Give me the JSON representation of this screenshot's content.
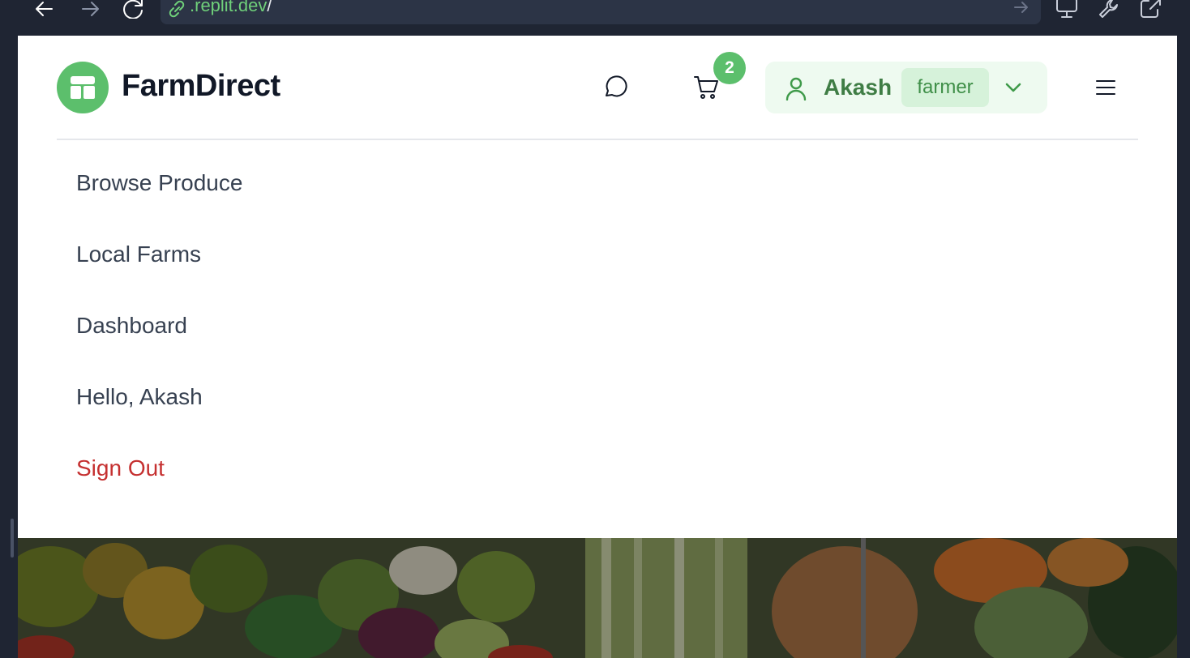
{
  "browser": {
    "url_host": ".replit.dev",
    "url_path": "/",
    "icons": [
      "back-arrow-icon",
      "forward-arrow-icon",
      "reload-icon",
      "link-icon",
      "go-arrow-icon",
      "monitor-icon",
      "wrench-icon",
      "external-link-icon"
    ]
  },
  "header": {
    "brand": "FarmDirect",
    "logo_icon": "storefront-icon",
    "chat_icon": "chat-bubble-icon",
    "cart_icon": "cart-icon",
    "cart_count": "2",
    "user": {
      "name": "Akash",
      "role": "farmer",
      "icon": "user-icon",
      "dropdown_icon": "chevron-down-icon"
    },
    "menu_icon": "hamburger-icon"
  },
  "nav": {
    "items": [
      {
        "label": "Browse Produce"
      },
      {
        "label": "Local Farms"
      },
      {
        "label": "Dashboard"
      },
      {
        "label": "Hello, Akash"
      },
      {
        "label": "Sign Out"
      }
    ]
  },
  "colors": {
    "brand_green": "#5cbf6c",
    "user_text_green": "#3f7d45",
    "signout_red": "#c53030",
    "chrome_bg": "#1f2533"
  }
}
